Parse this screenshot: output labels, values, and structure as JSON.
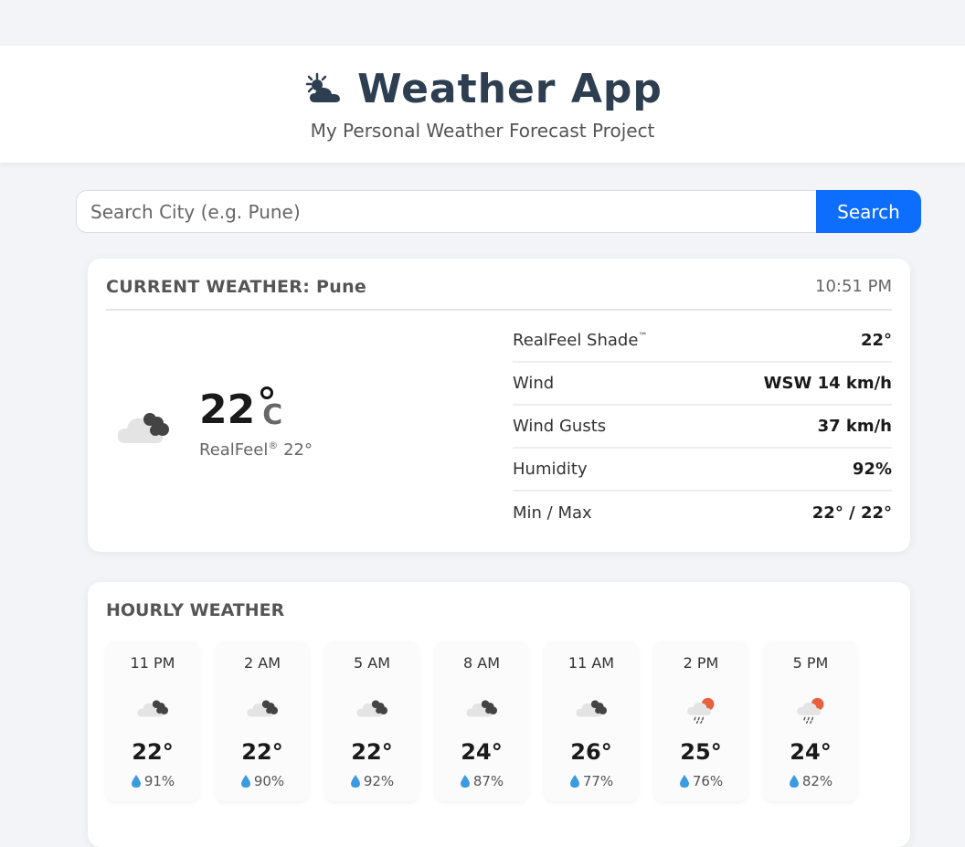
{
  "header": {
    "title": "Weather App",
    "subtitle": "My Personal Weather Forecast Project",
    "logo_icon": "sun-behind-cloud-icon"
  },
  "search": {
    "placeholder": "Search City (e.g. Pune)",
    "button_label": "Search",
    "button_color": "#0d6efd"
  },
  "current": {
    "title": "CURRENT WEATHER: Pune",
    "time": "10:51 PM",
    "icon": "cloudy-icon",
    "temperature": "22",
    "unit": "C",
    "realfeel_label": "RealFeel",
    "realfeel_mark": "®",
    "realfeel_value": "22°",
    "details": [
      {
        "label": "RealFeel Shade",
        "mark": "™",
        "value": "22°"
      },
      {
        "label": "Wind",
        "mark": "",
        "value": "WSW 14 km/h"
      },
      {
        "label": "Wind Gusts",
        "mark": "",
        "value": "37 km/h"
      },
      {
        "label": "Humidity",
        "mark": "",
        "value": "92%"
      },
      {
        "label": "Min / Max",
        "mark": "",
        "value": "22° / 22°"
      }
    ]
  },
  "hourly": {
    "title": "HOURLY WEATHER",
    "items": [
      {
        "time": "11 PM",
        "icon": "cloudy-icon",
        "temp": "22°",
        "humidity": "91%"
      },
      {
        "time": "2 AM",
        "icon": "cloudy-icon",
        "temp": "22°",
        "humidity": "90%"
      },
      {
        "time": "5 AM",
        "icon": "cloudy-icon",
        "temp": "22°",
        "humidity": "92%"
      },
      {
        "time": "8 AM",
        "icon": "cloudy-icon",
        "temp": "24°",
        "humidity": "87%"
      },
      {
        "time": "11 AM",
        "icon": "cloudy-icon",
        "temp": "26°",
        "humidity": "77%"
      },
      {
        "time": "2 PM",
        "icon": "sun-rain-icon",
        "temp": "25°",
        "humidity": "76%"
      },
      {
        "time": "5 PM",
        "icon": "sun-rain-icon",
        "temp": "24°",
        "humidity": "82%"
      }
    ]
  }
}
